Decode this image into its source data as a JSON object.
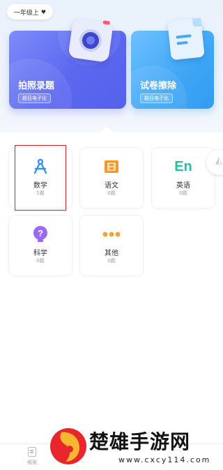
{
  "header": {
    "grade_label": "一年级上",
    "heart": "♥"
  },
  "cards": [
    {
      "title": "拍照录题",
      "tag": "题目电子化"
    },
    {
      "title": "试卷擦除",
      "tag": "题目电子化"
    }
  ],
  "subjects": [
    {
      "name": "数学",
      "count": "1题",
      "icon": "compass-icon",
      "color": "#3d8ff2"
    },
    {
      "name": "语文",
      "count": "0题",
      "icon": "book-icon",
      "color": "#f29a2e"
    },
    {
      "name": "英语",
      "count": "0题",
      "icon": "en-icon",
      "color": "#22c29a",
      "icon_text": "En"
    },
    {
      "name": "科学",
      "count": "0题",
      "icon": "question-icon",
      "color": "#9a6af2",
      "icon_text": "?"
    },
    {
      "name": "其他",
      "count": "0题",
      "icon": "dots-icon",
      "color": "#f2a33a"
    }
  ],
  "bottom_nav": [
    {
      "label": "纸张"
    }
  ],
  "watermark": {
    "text": "楚雄手游网",
    "url": "www.cxcy114.com"
  }
}
